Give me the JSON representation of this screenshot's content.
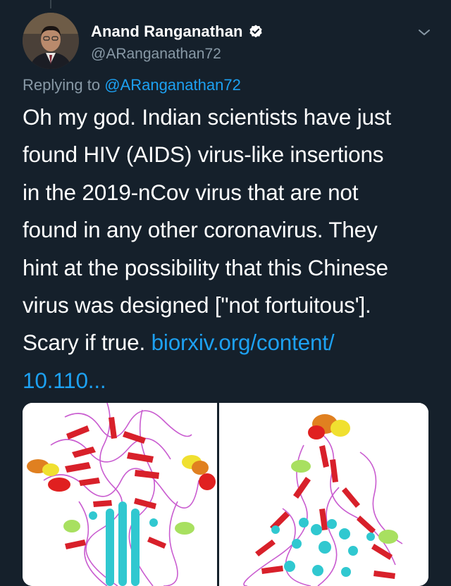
{
  "tweet": {
    "author": {
      "name": "Anand Ranganathan",
      "handle": "@ARanganathan72",
      "verified_icon": "verified-badge-icon"
    },
    "reply": {
      "prefix": "Replying to",
      "mention": "@ARanganathan72"
    },
    "text": {
      "line1": "Oh my god. Indian scientists have just",
      "line2": "found HIV (AIDS) virus-like insertions",
      "line3": "in the 2019-nCov virus that are not",
      "line4": "found in any other coronavirus. They",
      "line5": "hint at the possibility that this Chinese",
      "line6": "virus was designed [\"not fortuitous'].",
      "line7_prefix": "Scary if true.",
      "link_part1": "biorxiv.org/content/",
      "link_part2": "10.110..."
    },
    "media": {
      "left_image": "protein-structure-image",
      "right_image": "protein-structure-image"
    }
  },
  "colors": {
    "background": "#15202b",
    "accent": "#1da1f2",
    "secondary_text": "#8899a6"
  }
}
